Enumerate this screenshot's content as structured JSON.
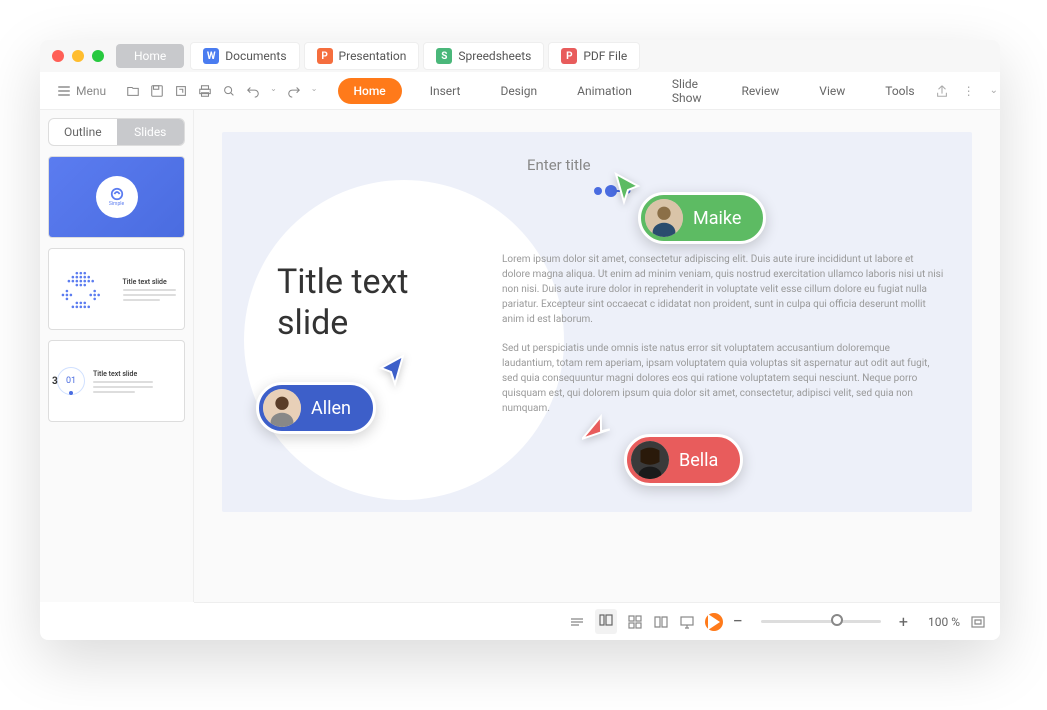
{
  "titlebar": {
    "home_label": "Home",
    "tabs": [
      {
        "icon": "W",
        "label": "Documents"
      },
      {
        "icon": "P",
        "label": "Presentation"
      },
      {
        "icon": "S",
        "label": "Spreedsheets"
      },
      {
        "icon": "P",
        "label": "PDF File"
      }
    ]
  },
  "toolbar": {
    "menu_label": "Menu",
    "ribbon_active": "Home",
    "ribbon_items": [
      "Insert",
      "Design",
      "Animation",
      "Slide Show",
      "Review",
      "View",
      "Tools"
    ]
  },
  "sidebar": {
    "outline_label": "Outline",
    "slides_label": "Slides",
    "thumbs": {
      "thumb1_label": "Simple",
      "thumb2_title": "Title text slide",
      "thumb3_chapter": "3",
      "thumb3_num": "01",
      "thumb3_title": "Title text slide"
    }
  },
  "slide": {
    "enter_title": "Enter title",
    "title_text": "Title text slide",
    "para1": "Lorem ipsum dolor sit amet, consectetur adipiscing elit. Duis aute irure incididunt ut labore et dolore magna aliqua. Ut enim ad minim veniam, quis nostrud exercitation ullamco laboris nisi ut nisi non nisi. Duis aute irure dolor in reprehenderit in voluptate velit esse cillum dolore eu fugiat nulla pariatur. Excepteur sint occaecat c ididatat non proident, sunt in culpa qui officia deserunt mollit anim id est laborum.",
    "para2": "Sed ut perspiciatis unde omnis iste natus error sit voluptatem accusantium doloremque laudantium, totam rem aperiam, ipsam voluptatem quia voluptas sit aspernatur aut odit aut fugit, sed quia consequuntur magni dolores eos qui ratione voluptatem sequi nesciunt. Neque porro quisquam est, qui dolorem ipsum quia dolor sit amet, consectetur, adipisci velit, sed quia non numquam."
  },
  "collaborators": {
    "maike": "Maike",
    "allen": "Allen",
    "bella": "Bella"
  },
  "statusbar": {
    "zoom_value": "100 %"
  },
  "colors": {
    "accent_orange": "#ff7a1a",
    "user_green": "#5dbb63",
    "user_blue": "#3d5fc9",
    "user_red": "#e85c5c"
  }
}
